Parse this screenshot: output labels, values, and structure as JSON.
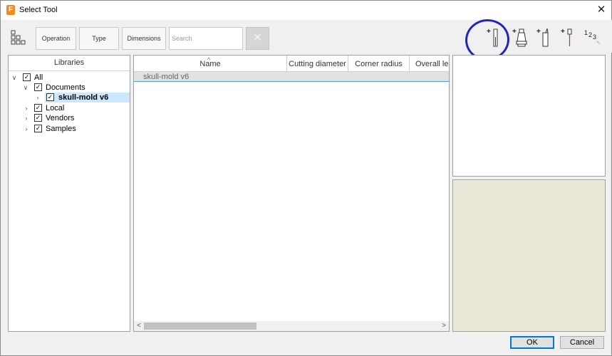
{
  "window": {
    "app_icon": "F",
    "title": "Select Tool",
    "close_glyph": "✕"
  },
  "toolbar": {
    "grid_icon": "library-grid-icon",
    "filters": [
      "Operation",
      "Type",
      "Dimensions"
    ],
    "search": {
      "placeholder": "Search",
      "value": ""
    },
    "clear_glyph": "✕",
    "tools": [
      {
        "name": "new-mill-tool-icon"
      },
      {
        "name": "new-holder-icon"
      },
      {
        "name": "new-turning-tool-icon"
      },
      {
        "name": "new-probe-icon"
      },
      {
        "name": "renumber-tools-icon",
        "glyph": "1 2 3"
      }
    ],
    "annotation_color": "#2424b8"
  },
  "libraries": {
    "header": "Libraries",
    "tree": [
      {
        "label": "All",
        "expanded": true,
        "checked": true,
        "level": 0
      },
      {
        "label": "Documents",
        "expanded": true,
        "checked": true,
        "level": 1
      },
      {
        "label": "skull-mold v6",
        "expanded": false,
        "checked": true,
        "level": 2,
        "selected": true
      },
      {
        "label": "Local",
        "expanded": false,
        "checked": true,
        "level": 1
      },
      {
        "label": "Vendors",
        "expanded": false,
        "checked": true,
        "level": 1
      },
      {
        "label": "Samples",
        "expanded": false,
        "checked": true,
        "level": 1
      }
    ]
  },
  "table": {
    "sort_indicator": "^",
    "columns": [
      "Name",
      "Cutting diameter",
      "Corner radius",
      "Overall length"
    ],
    "group_row": "skull-mold v6",
    "scroll_left": "<",
    "scroll_right": ">"
  },
  "colors": {
    "selection": "#cce8ff",
    "preview_bg": "#ebe7d9",
    "accent": "#0078d7"
  },
  "buttons": {
    "ok": "OK",
    "cancel": "Cancel"
  }
}
